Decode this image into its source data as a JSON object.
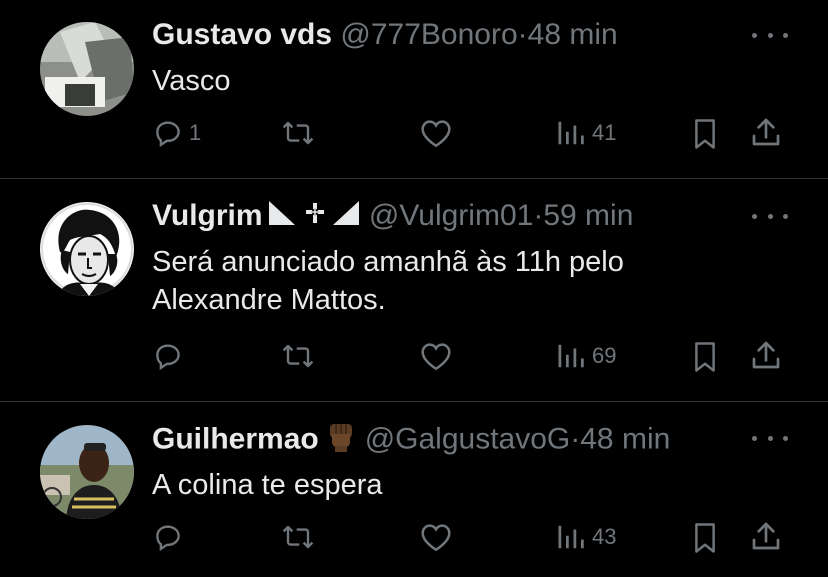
{
  "tweets": [
    {
      "name": "Gustavo vds",
      "handle": "@777Bonoro",
      "dot": "·",
      "time": "48 min",
      "lines": [
        "Vasco"
      ],
      "replies": "1",
      "retweets": "",
      "likes": "",
      "views": "41"
    },
    {
      "name": "Vulgrim",
      "handle": "@Vulgrim01",
      "dot": "·",
      "time": "59 min",
      "lines": [
        "Será anunciado amanhã às 11h pelo",
        "Alexandre Mattos."
      ],
      "replies": "",
      "retweets": "",
      "likes": "",
      "views": "69"
    },
    {
      "name": "Guilhermao",
      "handle": "@GalgustavoG",
      "dot": "·",
      "time": "48 min",
      "lines": [
        "A colina te espera"
      ],
      "replies": "",
      "retweets": "",
      "likes": "",
      "views": "43"
    }
  ],
  "icons": {
    "more": "more-dots-icon",
    "reply": "reply-icon",
    "retweet": "retweet-icon",
    "like": "heart-icon",
    "views": "views-chart-icon",
    "bookmark": "bookmark-icon",
    "share": "share-icon"
  },
  "colors": {
    "background": "#000000",
    "text": "#e7e9ea",
    "secondary": "#71767b",
    "divider": "#2f3336"
  }
}
